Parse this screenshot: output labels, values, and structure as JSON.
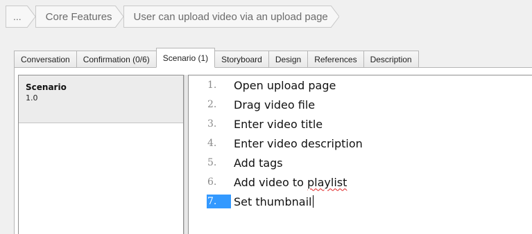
{
  "breadcrumb": {
    "items": [
      "...",
      "Core Features",
      "User can upload video via an upload page"
    ]
  },
  "tabs": [
    {
      "label": "Conversation"
    },
    {
      "label": "Confirmation (0/6)"
    },
    {
      "label": "Scenario (1)",
      "active": true
    },
    {
      "label": "Storyboard"
    },
    {
      "label": "Design"
    },
    {
      "label": "References"
    },
    {
      "label": "Description"
    }
  ],
  "scenario_list": {
    "items": [
      {
        "title": "Scenario",
        "version": "1.0"
      }
    ]
  },
  "editor": {
    "steps": [
      {
        "num": "1.",
        "text": "Open upload page"
      },
      {
        "num": "2.",
        "text": "Drag video file"
      },
      {
        "num": "3.",
        "text": "Enter video title"
      },
      {
        "num": "4.",
        "text": "Enter video description"
      },
      {
        "num": "5.",
        "text": "Add tags"
      },
      {
        "num": "6.",
        "text_before": "Add video to ",
        "text_misspelled": "playlist"
      },
      {
        "num": "7.",
        "text": "Set thumbnail",
        "current": true
      }
    ]
  },
  "colors": {
    "selection": "#3399ff",
    "spellcheck": "#e02020"
  }
}
